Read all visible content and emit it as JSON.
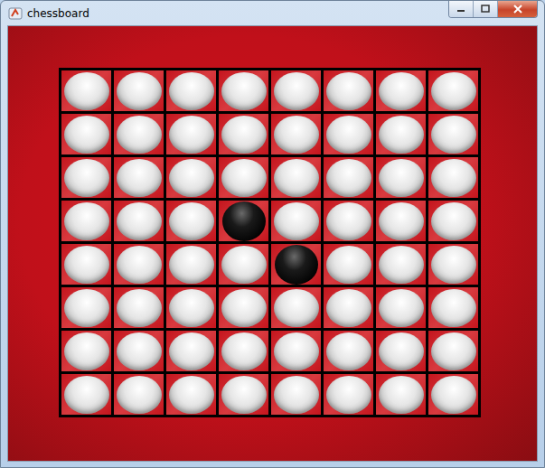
{
  "window": {
    "title": "chessboard"
  },
  "board": {
    "rows": [
      [
        {
          "piece": "white"
        },
        {
          "piece": "white"
        },
        {
          "piece": "white"
        },
        {
          "piece": "white"
        },
        {
          "piece": "white"
        },
        {
          "piece": "white"
        },
        {
          "piece": "white"
        },
        {
          "piece": "white"
        }
      ],
      [
        {
          "piece": "white"
        },
        {
          "piece": "white"
        },
        {
          "piece": "white"
        },
        {
          "piece": "white"
        },
        {
          "piece": "white"
        },
        {
          "piece": "white"
        },
        {
          "piece": "white"
        },
        {
          "piece": "white"
        }
      ],
      [
        {
          "piece": "white"
        },
        {
          "piece": "white"
        },
        {
          "piece": "white"
        },
        {
          "piece": "white"
        },
        {
          "piece": "white"
        },
        {
          "piece": "white"
        },
        {
          "piece": "white"
        },
        {
          "piece": "white"
        }
      ],
      [
        {
          "piece": "white"
        },
        {
          "piece": "white"
        },
        {
          "piece": "white"
        },
        {
          "piece": "black"
        },
        {
          "piece": "white"
        },
        {
          "piece": "white"
        },
        {
          "piece": "white"
        },
        {
          "piece": "white"
        }
      ],
      [
        {
          "piece": "white"
        },
        {
          "piece": "white"
        },
        {
          "piece": "white"
        },
        {
          "piece": "white"
        },
        {
          "piece": "black"
        },
        {
          "piece": "white"
        },
        {
          "piece": "white"
        },
        {
          "piece": "white"
        }
      ],
      [
        {
          "piece": "white"
        },
        {
          "piece": "white"
        },
        {
          "piece": "white"
        },
        {
          "piece": "white"
        },
        {
          "piece": "white"
        },
        {
          "piece": "white"
        },
        {
          "piece": "white"
        },
        {
          "piece": "white"
        }
      ],
      [
        {
          "piece": "white"
        },
        {
          "piece": "white"
        },
        {
          "piece": "white"
        },
        {
          "piece": "white"
        },
        {
          "piece": "white"
        },
        {
          "piece": "white"
        },
        {
          "piece": "white"
        },
        {
          "piece": "white"
        }
      ],
      [
        {
          "piece": "white"
        },
        {
          "piece": "white"
        },
        {
          "piece": "white"
        },
        {
          "piece": "white"
        },
        {
          "piece": "white"
        },
        {
          "piece": "white"
        },
        {
          "piece": "white"
        },
        {
          "piece": "white"
        }
      ]
    ]
  }
}
